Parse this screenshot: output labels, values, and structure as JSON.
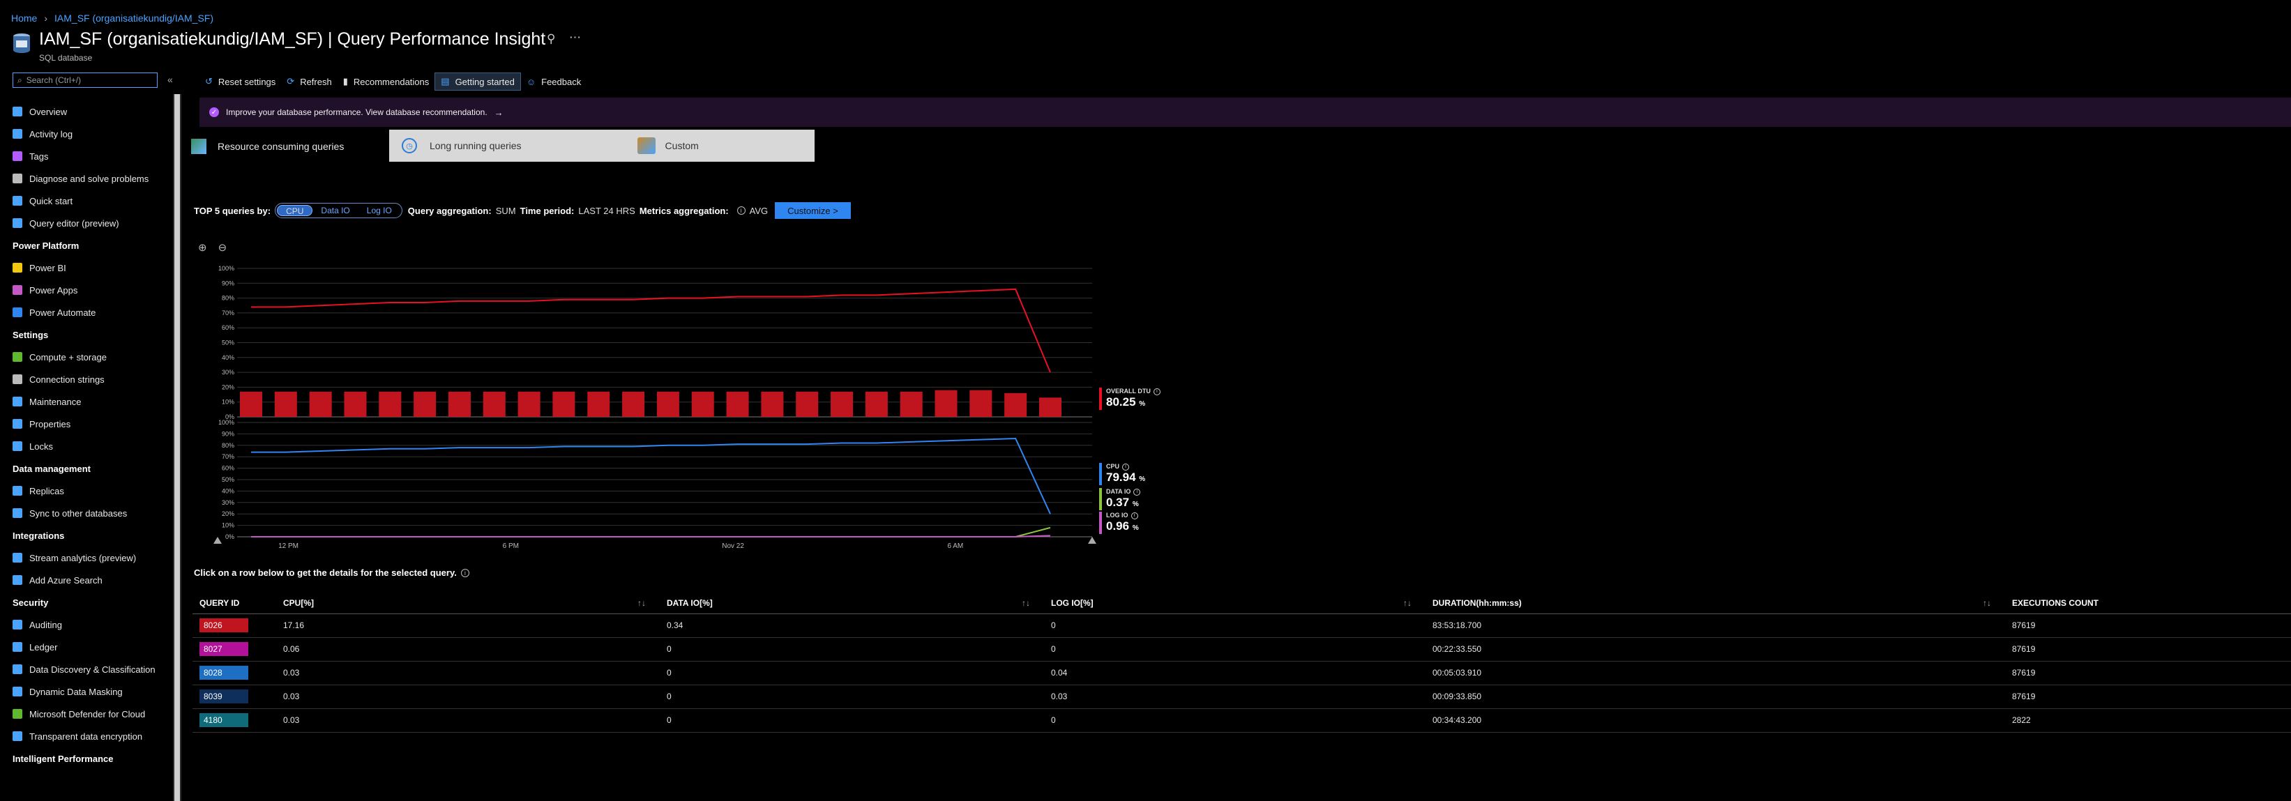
{
  "breadcrumb": {
    "home": "Home",
    "resource": "IAM_SF (organisatiekundig/IAM_SF)"
  },
  "header": {
    "title": "IAM_SF (organisatiekundig/IAM_SF) | Query Performance Insight",
    "subtitle": "SQL database",
    "pin": "pin-icon",
    "more": "ellipsis-icon"
  },
  "search": {
    "placeholder": "Search (Ctrl+/)",
    "collapse": "«"
  },
  "sidebar": {
    "items": [
      {
        "label": "Overview",
        "color": "#4aa3ff"
      },
      {
        "label": "Activity log",
        "color": "#4aa3ff"
      },
      {
        "label": "Tags",
        "color": "#b25bff"
      },
      {
        "label": "Diagnose and solve problems",
        "color": "#bbbbbb"
      },
      {
        "label": "Quick start",
        "color": "#4aa3ff"
      },
      {
        "label": "Query editor (preview)",
        "color": "#4aa3ff"
      }
    ],
    "section_power_platform": "Power Platform",
    "power_platform": [
      {
        "label": "Power BI",
        "color": "#f2c811"
      },
      {
        "label": "Power Apps",
        "color": "#c658c6"
      },
      {
        "label": "Power Automate",
        "color": "#2f86f0"
      }
    ],
    "section_settings": "Settings",
    "settings": [
      {
        "label": "Compute + storage",
        "color": "#5fb830"
      },
      {
        "label": "Connection strings",
        "color": "#bbbbbb"
      },
      {
        "label": "Maintenance",
        "color": "#4aa3ff"
      },
      {
        "label": "Properties",
        "color": "#4aa3ff"
      },
      {
        "label": "Locks",
        "color": "#4aa3ff"
      }
    ],
    "section_data_management": "Data management",
    "data_management": [
      {
        "label": "Replicas",
        "color": "#4aa3ff"
      },
      {
        "label": "Sync to other databases",
        "color": "#4aa3ff"
      }
    ],
    "section_integrations": "Integrations",
    "integrations": [
      {
        "label": "Stream analytics (preview)",
        "color": "#4aa3ff"
      },
      {
        "label": "Add Azure Search",
        "color": "#4aa3ff"
      }
    ],
    "section_security": "Security",
    "security": [
      {
        "label": "Auditing",
        "color": "#4aa3ff"
      },
      {
        "label": "Ledger",
        "color": "#4aa3ff"
      },
      {
        "label": "Data Discovery & Classification",
        "color": "#4aa3ff"
      },
      {
        "label": "Dynamic Data Masking",
        "color": "#4aa3ff"
      },
      {
        "label": "Microsoft Defender for Cloud",
        "color": "#5fb830"
      },
      {
        "label": "Transparent data encryption",
        "color": "#4aa3ff"
      }
    ],
    "section_intelligent": "Intelligent Performance"
  },
  "toolbar": {
    "reset": "Reset settings",
    "refresh": "Refresh",
    "recommendations": "Recommendations",
    "getting_started": "Getting started",
    "feedback": "Feedback"
  },
  "banner": {
    "text": "Improve your database performance. View database recommendation.",
    "arrow": "→"
  },
  "tabs": {
    "resource": "Resource consuming queries",
    "long_running": "Long running queries",
    "custom": "Custom"
  },
  "filters": {
    "top5_label": "TOP 5 queries by:",
    "cpu": "CPU",
    "data_io": "Data IO",
    "log_io": "Log IO",
    "agg_label": "Query aggregation:",
    "agg_value": "SUM",
    "period_label": "Time period:",
    "period_value": "LAST 24 HRS",
    "metrics_label": "Metrics aggregation:",
    "metrics_value": "AVG",
    "customize": "Customize >"
  },
  "metrics": {
    "overall_dtu": {
      "label": "OVERALL DTU",
      "value": "80.25",
      "unit": "%",
      "color": "#e81123"
    },
    "cpu": {
      "label": "CPU",
      "value": "79.94",
      "unit": "%",
      "color": "#2f86f0"
    },
    "data_io": {
      "label": "DATA IO",
      "value": "0.37",
      "unit": "%",
      "color": "#8cc43c"
    },
    "log_io": {
      "label": "LOG IO",
      "value": "0.96",
      "unit": "%",
      "color": "#c658c6"
    }
  },
  "chart_data": [
    {
      "type": "line",
      "panel": "top",
      "yticks": [
        "100%",
        "90%",
        "80%",
        "70%",
        "60%",
        "50%",
        "40%",
        "30%",
        "20%",
        "10%",
        "0%"
      ],
      "ylim": [
        0,
        100
      ],
      "series": [
        {
          "name": "OVERALL DTU",
          "color": "#e81123",
          "values": [
            74,
            74,
            75,
            76,
            77,
            77,
            78,
            78,
            78,
            79,
            79,
            79,
            80,
            80,
            81,
            81,
            81,
            82,
            82,
            83,
            84,
            85,
            86,
            30
          ]
        }
      ],
      "bars": {
        "color": "#c0141f",
        "values": [
          17,
          17,
          17,
          17,
          17,
          17,
          17,
          17,
          17,
          17,
          17,
          17,
          17,
          17,
          17,
          17,
          17,
          17,
          17,
          17,
          18,
          18,
          16,
          13
        ]
      }
    },
    {
      "type": "line",
      "panel": "bottom",
      "yticks": [
        "100%",
        "90%",
        "80%",
        "70%",
        "60%",
        "50%",
        "40%",
        "30%",
        "20%",
        "10%",
        "0%"
      ],
      "ylim": [
        0,
        100
      ],
      "xticks": [
        "12 PM",
        "6 PM",
        "Nov 22",
        "6 AM"
      ],
      "series": [
        {
          "name": "CPU",
          "color": "#2f86f0",
          "values": [
            74,
            74,
            75,
            76,
            77,
            77,
            78,
            78,
            78,
            79,
            79,
            79,
            80,
            80,
            81,
            81,
            81,
            82,
            82,
            83,
            84,
            85,
            86,
            20
          ]
        },
        {
          "name": "DATA IO",
          "color": "#8cc43c",
          "values": [
            0,
            0,
            0,
            0,
            0,
            0,
            0,
            0,
            0,
            0,
            0,
            0,
            0,
            0,
            0,
            0,
            0,
            0,
            0,
            0,
            0,
            0,
            0,
            8
          ]
        },
        {
          "name": "LOG IO",
          "color": "#c658c6",
          "values": [
            0,
            0,
            0,
            0,
            0,
            0,
            0,
            0,
            0,
            0,
            0,
            0,
            0,
            0,
            0,
            0,
            0,
            0,
            0,
            0,
            0,
            0,
            0,
            1
          ]
        }
      ]
    }
  ],
  "hint": "Click on a row below to get the details for the selected query.",
  "table": {
    "headers": [
      "QUERY ID",
      "CPU[%]",
      "DATA IO[%]",
      "LOG IO[%]",
      "DURATION(hh:mm:ss)",
      "EXECUTIONS COUNT"
    ],
    "rows": [
      {
        "id": "8026",
        "color": "#c0141f",
        "cpu": "17.16",
        "data_io": "0.34",
        "log_io": "0",
        "duration": "83:53:18.700",
        "count": "87619"
      },
      {
        "id": "8027",
        "color": "#b4119a",
        "cpu": "0.06",
        "data_io": "0",
        "log_io": "0",
        "duration": "00:22:33.550",
        "count": "87619"
      },
      {
        "id": "8028",
        "color": "#1d6fc4",
        "cpu": "0.03",
        "data_io": "0",
        "log_io": "0.04",
        "duration": "00:05:03.910",
        "count": "87619"
      },
      {
        "id": "8039",
        "color": "#0e2f5c",
        "cpu": "0.03",
        "data_io": "0",
        "log_io": "0.03",
        "duration": "00:09:33.850",
        "count": "87619"
      },
      {
        "id": "4180",
        "color": "#0f6b7a",
        "cpu": "0.03",
        "data_io": "0",
        "log_io": "0",
        "duration": "00:34:43.200",
        "count": "2822"
      }
    ]
  }
}
